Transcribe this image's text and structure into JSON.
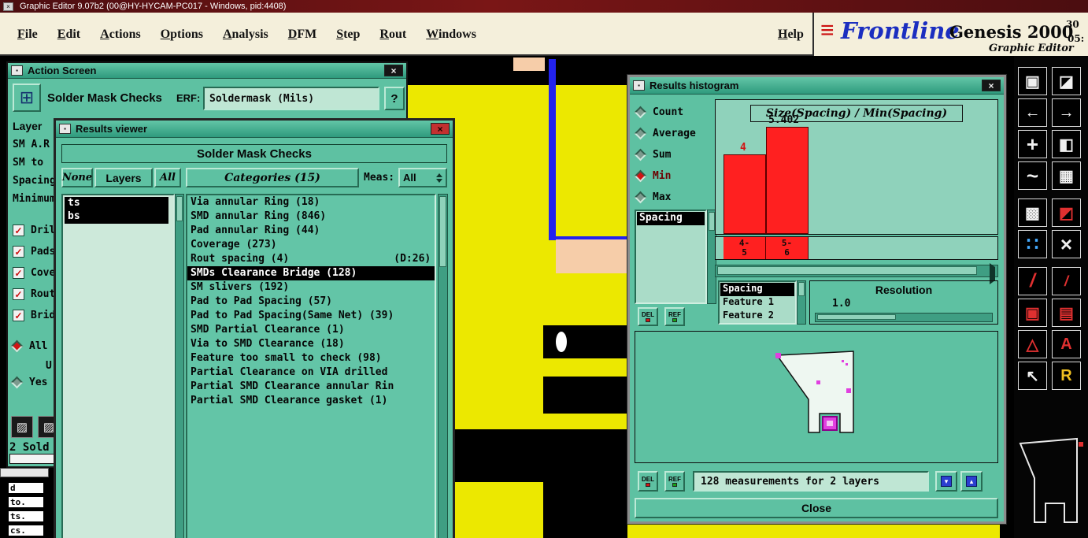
{
  "colors": {
    "titlebar_maroon": "#4b0d10",
    "menubar_cream": "#f4efdb",
    "window_teal": "#5ec1a2",
    "panel_light_teal": "#aadcc8",
    "highlight_bg": "#000000",
    "highlight_fg": "#ffffff",
    "bar_red": "#ff2020",
    "canvas_yellow": "#ece800",
    "canvas_salmon": "#f6cda9",
    "canvas_blue": "#2222ee",
    "magenta": "#e040e0",
    "logo_blue": "#1b2ec0",
    "logo_red": "#cc1111"
  },
  "icons": {
    "close": "×",
    "window_menu": "▪",
    "check": "✓"
  },
  "titlebar": {
    "title": "Graphic Editor 9.07b2 (00@HY-HYCAM-PC017 - Windows, pid:4408)"
  },
  "menubar": {
    "items": [
      "File",
      "Edit",
      "Actions",
      "Options",
      "Analysis",
      "DFM",
      "Step",
      "Rout",
      "Windows"
    ],
    "help": "Help"
  },
  "brand": {
    "logo_mark": "≡",
    "logo_text": "Frontline",
    "product": "Genesis 2000",
    "subtitle": "Graphic Editor",
    "corner_top": "30",
    "corner_bottom": "05:"
  },
  "action_screen": {
    "title": "Action Screen",
    "icon_glyph": "⊞",
    "heading": "Solder Mask Checks",
    "erf_label": "ERF:",
    "erf_value": "Soldermask (Mils)",
    "help_button": "?",
    "section_labels": [
      "Layer",
      "SM A.R",
      "SM to",
      "Spacing",
      "Minimum"
    ],
    "checkboxes": [
      "Dril",
      "Pads",
      "Cove",
      "Rout",
      "Brid"
    ],
    "radio_all": "All",
    "fragment_u": "U",
    "radio_yes": "Yes",
    "pattern_icons": [
      "▨",
      "▨"
    ],
    "status_text": "2 Sold"
  },
  "results_viewer": {
    "title": "Results viewer",
    "header": "Solder Mask Checks",
    "button_none": "None",
    "button_layers": "Layers",
    "button_all": "All",
    "categories_button": "Categories (15)",
    "meas_label": "Meas:",
    "meas_value": "All",
    "layers": [
      "ts",
      "bs"
    ],
    "selected_category": "SMDs Clearance Bridge (128)",
    "categories": [
      "Via annular Ring (18)",
      "SMD annular Ring (846)",
      "Pad annular Ring (44)",
      "Coverage (273)",
      "Rout spacing (4)                 (D:26)",
      "SMDs Clearance Bridge (128)",
      "SM slivers (192)",
      "Pad to Pad Spacing (57)",
      "Pad to Pad Spacing(Same Net) (39)",
      "SMD Partial Clearance (1)",
      "Via to SMD Clearance (18)",
      "Feature too small to check (98)",
      "Partial Clearance on VIA drilled",
      "Partial SMD Clearance annular Rin",
      "Partial SMD Clearance gasket (1)"
    ]
  },
  "results_histogram": {
    "title": "Results histogram",
    "stats": [
      "Count",
      "Average",
      "Sum",
      "Min",
      "Max"
    ],
    "selected_stat": "Min",
    "measures": [
      "Spacing"
    ],
    "del_label": "DEL",
    "ref_label": "REF",
    "feature_items": [
      "Spacing",
      "Feature 1",
      "Feature 2"
    ],
    "selected_feature": "Spacing",
    "resolution_label": "Resolution",
    "resolution_value": "1.0",
    "measurements_text": "128 measurements for 2 layers",
    "icon_buttons": [
      {
        "name": "box-arrow-down-icon",
        "glyph": "▾"
      },
      {
        "name": "box-arrow-up-icon",
        "glyph": "▴"
      }
    ],
    "close_label": "Close"
  },
  "chart_data": {
    "type": "bar",
    "title": "Size(Spacing) / Min(Spacing)",
    "stat": "Min",
    "measure": "Spacing",
    "categories": [
      "4-5",
      "5-6"
    ],
    "values": [
      4.0,
      5.402
    ],
    "bar_labels": [
      "4",
      "5.402"
    ],
    "bin_labels": [
      [
        "4-",
        "5"
      ],
      [
        "5-",
        "6"
      ]
    ],
    "ylim": [
      0,
      5.402
    ],
    "bar_color": "#ff2020",
    "legend": "none",
    "total_text": "128 measurements for 2 layers"
  },
  "bottom_left_list": {
    "items": [
      "d",
      "to.",
      "ts.",
      "cs."
    ]
  },
  "toolbar": {
    "icons": [
      {
        "name": "stack-icon",
        "glyph": "▣"
      },
      {
        "name": "window-corner-icon",
        "glyph": "◪"
      },
      {
        "name": "shift-left-icon",
        "glyph": "←"
      },
      {
        "name": "shift-right-icon",
        "glyph": "→"
      },
      {
        "name": "pan-icon",
        "glyph": "+"
      },
      {
        "name": "half-box-icon",
        "glyph": "◧"
      },
      {
        "name": "curve-icon",
        "glyph": "~"
      },
      {
        "name": "table-icon",
        "glyph": "▦"
      },
      {
        "name": "fill-icon",
        "glyph": "▩"
      },
      {
        "name": "swap-icon",
        "glyph": "◩"
      },
      {
        "name": "points-icon",
        "glyph": "∷"
      },
      {
        "name": "delete-icon",
        "glyph": "×"
      },
      {
        "name": "line-tool-icon",
        "glyph": "/"
      },
      {
        "name": "measure-line-icon",
        "glyph": "/"
      },
      {
        "name": "pad-red-icon",
        "glyph": "▣"
      },
      {
        "name": "hatch-red-icon",
        "glyph": "▤"
      },
      {
        "name": "triangle-tool-icon",
        "glyph": "△"
      },
      {
        "name": "text-tool-icon",
        "glyph": "A"
      },
      {
        "name": "cursor-icon",
        "glyph": "↖"
      },
      {
        "name": "rout-tool-icon",
        "glyph": "R"
      }
    ]
  }
}
